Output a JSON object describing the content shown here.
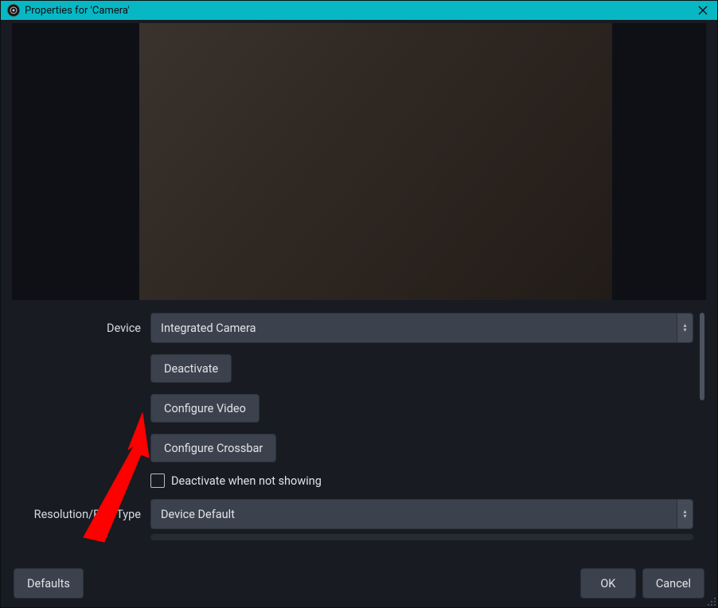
{
  "window": {
    "title": "Properties for 'Camera'"
  },
  "form": {
    "device_label": "Device",
    "device_value": "Integrated Camera",
    "deactivate_btn": "Deactivate",
    "configure_video_btn": "Configure Video",
    "configure_crossbar_btn": "Configure Crossbar",
    "deactivate_when_not_showing_label": "Deactivate when not showing",
    "resolution_fps_label": "Resolution/FPS Type",
    "resolution_fps_value": "Device Default"
  },
  "footer": {
    "defaults": "Defaults",
    "ok": "OK",
    "cancel": "Cancel"
  }
}
